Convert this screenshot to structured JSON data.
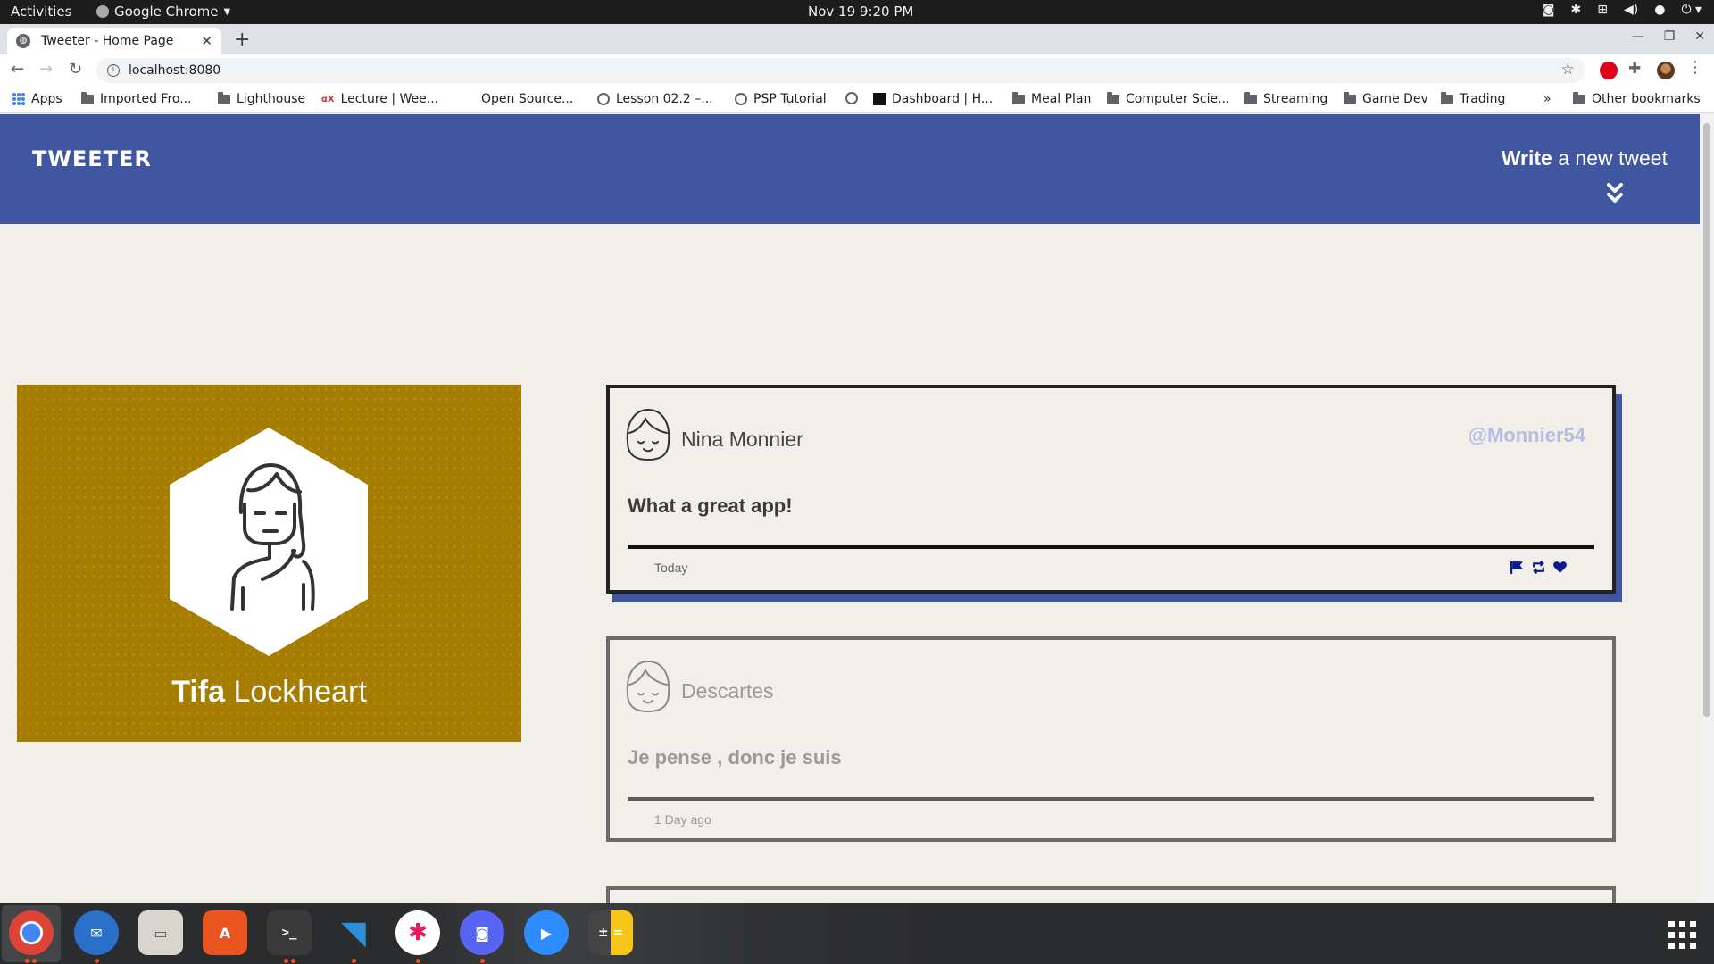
{
  "system_bar": {
    "activities": "Activities",
    "app_name": "Google Chrome",
    "clock": "Nov 19  9:20 PM"
  },
  "browser": {
    "tab_title": "Tweeter - Home Page",
    "url": "localhost:8080",
    "bookmarks": [
      {
        "label": "Apps",
        "icon": "apps-grid-icon"
      },
      {
        "label": "Imported Fro...",
        "icon": "folder-icon"
      },
      {
        "label": "Lighthouse",
        "icon": "folder-icon"
      },
      {
        "label": "Lecture | Wee...",
        "icon": "site-icon"
      },
      {
        "label": "Open Source...",
        "icon": "none"
      },
      {
        "label": "Lesson 02.2 –...",
        "icon": "globe-icon"
      },
      {
        "label": "PSP Tutorial",
        "icon": "globe-icon"
      },
      {
        "label": "",
        "icon": "globe-icon"
      },
      {
        "label": "Dashboard | H...",
        "icon": "site-icon"
      },
      {
        "label": "Meal Plan",
        "icon": "folder-icon"
      },
      {
        "label": "Computer Scie...",
        "icon": "folder-icon"
      },
      {
        "label": "Streaming",
        "icon": "folder-icon"
      },
      {
        "label": "Game Dev",
        "icon": "folder-icon"
      },
      {
        "label": "Trading",
        "icon": "folder-icon"
      }
    ],
    "overflow": "»",
    "other_bookmarks": "Other bookmarks"
  },
  "site": {
    "brand": "TWEETER",
    "compose_bold": "Write",
    "compose_rest": " a new tweet",
    "accent_color": "#4056a1"
  },
  "profile": {
    "first_name": "Tifa",
    "last_name": " Lockheart",
    "card_color": "#a67d00"
  },
  "tweets": [
    {
      "author": "Nina Monnier",
      "handle": "@Monnier54",
      "content": "What a great app!",
      "date": "Today"
    },
    {
      "author": "Descartes",
      "handle": "",
      "content": "Je pense , donc je suis",
      "date": "1 Day ago"
    }
  ]
}
